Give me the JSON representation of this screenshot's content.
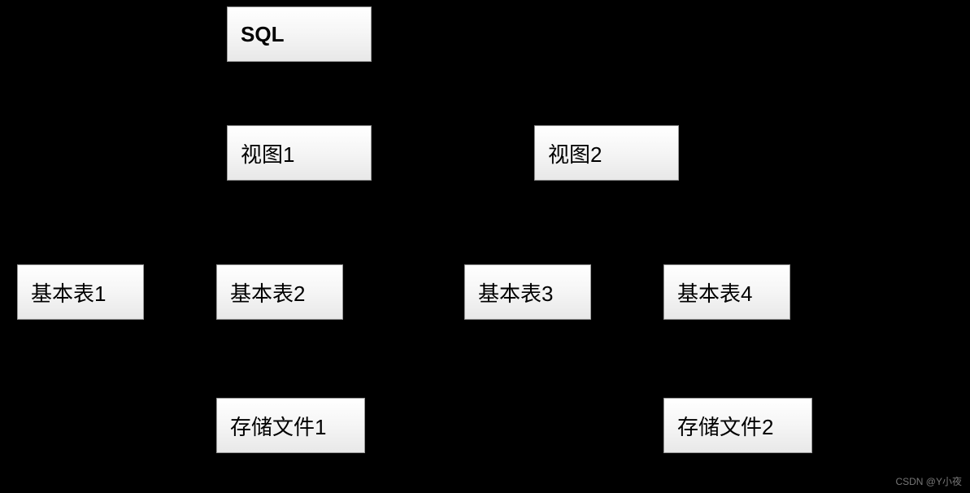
{
  "nodes": {
    "sql": "SQL",
    "view1": "视图1",
    "view2": "视图2",
    "table1": "基本表1",
    "table2": "基本表2",
    "table3": "基本表3",
    "table4": "基本表4",
    "file1": "存储文件1",
    "file2": "存储文件2"
  },
  "watermark": "CSDN @Y小夜"
}
